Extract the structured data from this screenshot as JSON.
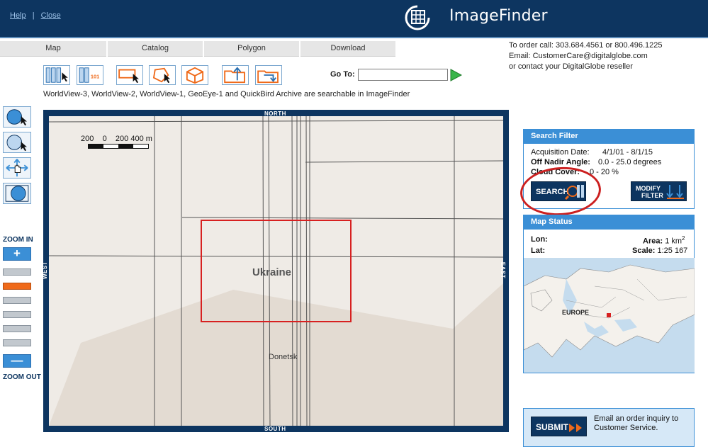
{
  "header": {
    "help_link": "Help",
    "separator": "|",
    "close_link": "Close",
    "app_title": "ImageFinder"
  },
  "tabs": [
    "Map",
    "Catalog",
    "Polygon",
    "Download"
  ],
  "contact": {
    "line1": "To order call: 303.684.4561 or 800.496.1225",
    "line2": "Email: CustomerCare@digitalglobe.com",
    "line3": "or contact your DigitalGlobe reseller"
  },
  "toolbar": {
    "goto_label": "Go To:",
    "goto_value": "",
    "tool_icon_text": "101",
    "archive_note": "WorldView-3, WorldView-2, WorldView-1, GeoEye-1 and QuickBird Archive are searchable in ImageFinder"
  },
  "zoom": {
    "zoom_in_label": "ZOOM IN",
    "zoom_out_label": "ZOOM OUT",
    "plus": "+",
    "minus": "—",
    "level": 2,
    "levels": 6
  },
  "map": {
    "north": "NORTH",
    "south": "SOUTH",
    "west": "WEST",
    "east": "EAST",
    "region_label": "Ukraine",
    "city_label": "Donetsk",
    "scale_text": "200    0    200 400 m"
  },
  "search_filter": {
    "title": "Search Filter",
    "acq_label": "Acquisition Date:",
    "acq_value": "4/1/01 - 8/1/15",
    "nadir_label": "Off Nadir Angle:",
    "nadir_value": "0.0 - 25.0 degrees",
    "cloud_label": "Cloud Cover:",
    "cloud_value": "0 - 20 %",
    "search_button": "SEARCH",
    "modify_button_line1": "MODIFY",
    "modify_button_line2": "FILTER"
  },
  "map_status": {
    "title": "Map Status",
    "lon_label": "Lon:",
    "lat_label": "Lat:",
    "area_label": "Area:",
    "area_value": "1 km",
    "area_exp": "2",
    "scale_label": "Scale:",
    "scale_value": "1:25 167",
    "overview_label": "EUROPE"
  },
  "submit": {
    "button": "SUBMIT",
    "text": "Email an order inquiry to Customer Service."
  },
  "colors": {
    "header_bg": "#0d3560",
    "accent": "#3b8fd6",
    "zoom_active": "#ef6a1a",
    "aoi_box": "#d72020"
  }
}
